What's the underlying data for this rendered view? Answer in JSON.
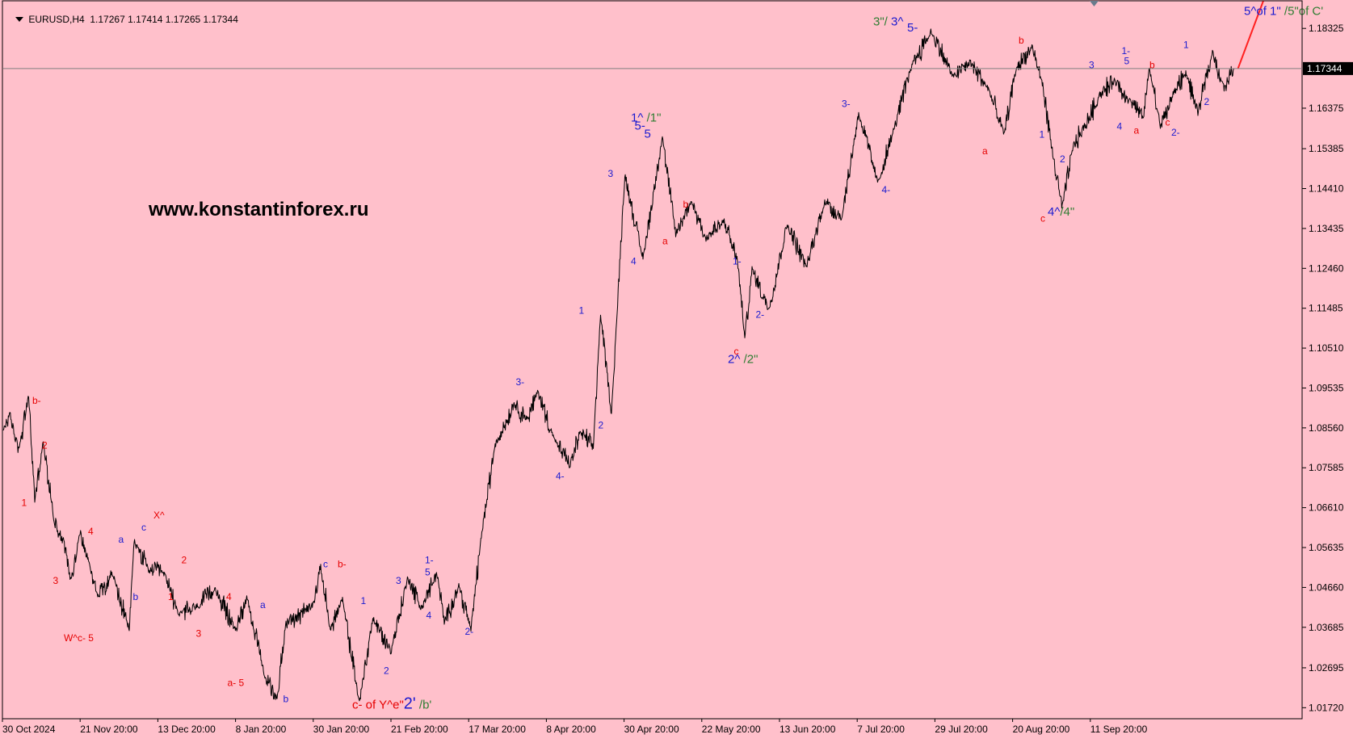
{
  "header": {
    "symbol": "EURUSD,H4",
    "ohlc": "1.17267 1.17414 1.17265 1.17344"
  },
  "watermark": "www.konstantinforex.ru",
  "colors": {
    "background": "#ffc0cb",
    "price_line": "#000000",
    "red_labels": "#e60000",
    "blue_labels": "#1a1ad0",
    "green_labels": "#2e7d32",
    "projection": "#ff2020",
    "current_price_box": "#000000"
  },
  "chart_data": {
    "type": "line",
    "title": "EURUSD,H4",
    "grid": false,
    "current_price": 1.17344,
    "current_price_label": "1.17344",
    "y_tick_labels": [
      "1.18325",
      "1.17344",
      "1.16375",
      "1.15385",
      "1.14410",
      "1.13435",
      "1.12460",
      "1.11485",
      "1.10510",
      "1.09535",
      "1.08560",
      "1.07585",
      "1.06610",
      "1.05635",
      "1.04660",
      "1.03685",
      "1.02695",
      "1.01720"
    ],
    "y_ticks": [
      1.18325,
      1.16375,
      1.15385,
      1.1441,
      1.13435,
      1.1246,
      1.11485,
      1.1051,
      1.09535,
      1.0856,
      1.07585,
      1.0661,
      1.05635,
      1.0466,
      1.03685,
      1.02695,
      1.0172
    ],
    "ylim": [
      1.0145,
      1.19
    ],
    "x_tick_labels": [
      "30 Oct 2024",
      "21 Nov 20:00",
      "13 Dec 20:00",
      "8 Jan 20:00",
      "30 Jan 20:00",
      "21 Feb 20:00",
      "17 Mar 20:00",
      "8 Apr 20:00",
      "30 Apr 20:00",
      "22 May 20:00",
      "13 Jun 20:00",
      "7 Jul 20:00",
      "29 Jul 20:00",
      "20 Aug 20:00",
      "11 Sep 20:00"
    ],
    "key_points": [
      {
        "t": 0.0,
        "y": 1.085
      },
      {
        "t": 0.5,
        "y": 1.089
      },
      {
        "t": 1.3,
        "y": 1.08
      },
      {
        "t": 2.1,
        "y": 1.0935
      },
      {
        "t": 2.6,
        "y": 1.068
      },
      {
        "t": 3.3,
        "y": 1.082
      },
      {
        "t": 4.2,
        "y": 1.063
      },
      {
        "t": 5.0,
        "y": 1.058
      },
      {
        "t": 5.6,
        "y": 1.048
      },
      {
        "t": 6.3,
        "y": 1.06
      },
      {
        "t": 7.0,
        "y": 1.0535
      },
      {
        "t": 7.8,
        "y": 1.045
      },
      {
        "t": 9.0,
        "y": 1.05
      },
      {
        "t": 10.4,
        "y": 1.036
      },
      {
        "t": 10.8,
        "y": 1.058
      },
      {
        "t": 12.0,
        "y": 1.051
      },
      {
        "t": 13.3,
        "y": 1.05
      },
      {
        "t": 14.5,
        "y": 1.04
      },
      {
        "t": 16.0,
        "y": 1.042
      },
      {
        "t": 17.5,
        "y": 1.046
      },
      {
        "t": 19.2,
        "y": 1.036
      },
      {
        "t": 20.1,
        "y": 1.0445
      },
      {
        "t": 21.6,
        "y": 1.0245
      },
      {
        "t": 22.6,
        "y": 1.0195
      },
      {
        "t": 23.3,
        "y": 1.0375
      },
      {
        "t": 25.6,
        "y": 1.0425
      },
      {
        "t": 26.2,
        "y": 1.0515
      },
      {
        "t": 27.0,
        "y": 1.0365
      },
      {
        "t": 28.0,
        "y": 1.0435
      },
      {
        "t": 29.4,
        "y": 1.0185
      },
      {
        "t": 30.5,
        "y": 1.039
      },
      {
        "t": 32.0,
        "y": 1.031
      },
      {
        "t": 33.4,
        "y": 1.049
      },
      {
        "t": 34.5,
        "y": 1.0415
      },
      {
        "t": 35.8,
        "y": 1.05
      },
      {
        "t": 36.4,
        "y": 1.038
      },
      {
        "t": 37.6,
        "y": 1.047
      },
      {
        "t": 38.6,
        "y": 1.0365
      },
      {
        "t": 39.5,
        "y": 1.06
      },
      {
        "t": 40.6,
        "y": 1.0815
      },
      {
        "t": 42.2,
        "y": 1.0915
      },
      {
        "t": 43.3,
        "y": 1.0875
      },
      {
        "t": 44.1,
        "y": 1.0945
      },
      {
        "t": 45.6,
        "y": 1.082
      },
      {
        "t": 46.8,
        "y": 1.0765
      },
      {
        "t": 47.6,
        "y": 1.0845
      },
      {
        "t": 48.7,
        "y": 1.081
      },
      {
        "t": 49.3,
        "y": 1.1135
      },
      {
        "t": 50.2,
        "y": 1.089
      },
      {
        "t": 51.3,
        "y": 1.1475
      },
      {
        "t": 52.8,
        "y": 1.127
      },
      {
        "t": 54.4,
        "y": 1.1565
      },
      {
        "t": 55.5,
        "y": 1.133
      },
      {
        "t": 56.8,
        "y": 1.141
      },
      {
        "t": 58.0,
        "y": 1.132
      },
      {
        "t": 59.5,
        "y": 1.136
      },
      {
        "t": 60.6,
        "y": 1.1265
      },
      {
        "t": 61.2,
        "y": 1.1075
      },
      {
        "t": 61.8,
        "y": 1.1245
      },
      {
        "t": 63.2,
        "y": 1.1145
      },
      {
        "t": 64.7,
        "y": 1.1355
      },
      {
        "t": 66.3,
        "y": 1.125
      },
      {
        "t": 67.8,
        "y": 1.141
      },
      {
        "t": 69.2,
        "y": 1.137
      },
      {
        "t": 70.6,
        "y": 1.1625
      },
      {
        "t": 72.2,
        "y": 1.1455
      },
      {
        "t": 73.5,
        "y": 1.1585
      },
      {
        "t": 75.0,
        "y": 1.1745
      },
      {
        "t": 76.6,
        "y": 1.1825
      },
      {
        "t": 78.4,
        "y": 1.1715
      },
      {
        "t": 79.8,
        "y": 1.175
      },
      {
        "t": 81.3,
        "y": 1.1685
      },
      {
        "t": 82.6,
        "y": 1.1575
      },
      {
        "t": 83.6,
        "y": 1.1735
      },
      {
        "t": 84.9,
        "y": 1.1785
      },
      {
        "t": 85.8,
        "y": 1.1695
      },
      {
        "t": 86.5,
        "y": 1.1545
      },
      {
        "t": 87.4,
        "y": 1.1395
      },
      {
        "t": 88.3,
        "y": 1.1545
      },
      {
        "t": 89.2,
        "y": 1.159
      },
      {
        "t": 90.5,
        "y": 1.167
      },
      {
        "t": 91.7,
        "y": 1.1705
      },
      {
        "t": 93.0,
        "y": 1.1655
      },
      {
        "t": 94.1,
        "y": 1.1615
      },
      {
        "t": 94.6,
        "y": 1.1735
      },
      {
        "t": 95.5,
        "y": 1.1595
      },
      {
        "t": 96.8,
        "y": 1.1685
      },
      {
        "t": 97.6,
        "y": 1.1725
      },
      {
        "t": 98.6,
        "y": 1.1625
      },
      {
        "t": 99.8,
        "y": 1.1775
      },
      {
        "t": 100.8,
        "y": 1.1685
      },
      {
        "t": 101.6,
        "y": 1.1734
      }
    ],
    "projection": [
      {
        "t": 101.9,
        "y": 1.1734
      },
      {
        "t": 104.0,
        "y": 1.19
      }
    ],
    "annotations": [
      {
        "text": "b-",
        "t": 2.4,
        "y": 1.0915,
        "color": "red"
      },
      {
        "text": "2",
        "t": 3.2,
        "y": 1.0805,
        "color": "red"
      },
      {
        "text": "1",
        "t": 1.5,
        "y": 1.0665,
        "color": "red"
      },
      {
        "text": "4",
        "t": 7.0,
        "y": 1.0595,
        "color": "red"
      },
      {
        "text": "3",
        "t": 4.1,
        "y": 1.0475,
        "color": "red"
      },
      {
        "text": "W^c- 5",
        "t": 5.0,
        "y": 1.0335,
        "color": "red"
      },
      {
        "text": "a",
        "t": 9.5,
        "y": 1.0575,
        "color": "blue"
      },
      {
        "text": "c",
        "t": 11.4,
        "y": 1.0605,
        "color": "blue"
      },
      {
        "text": "X^",
        "t": 12.4,
        "y": 1.0635,
        "color": "red"
      },
      {
        "text": "b",
        "t": 10.7,
        "y": 1.0435,
        "color": "blue"
      },
      {
        "text": "2",
        "t": 14.7,
        "y": 1.0525,
        "color": "red"
      },
      {
        "text": "1",
        "t": 13.6,
        "y": 1.0435,
        "color": "red"
      },
      {
        "text": "4",
        "t": 18.4,
        "y": 1.0435,
        "color": "red"
      },
      {
        "text": "3",
        "t": 15.9,
        "y": 1.0345,
        "color": "red"
      },
      {
        "text": "a",
        "t": 21.2,
        "y": 1.0415,
        "color": "blue"
      },
      {
        "text": "a- 5",
        "t": 18.5,
        "y": 1.0225,
        "color": "red"
      },
      {
        "text": "b",
        "t": 23.1,
        "y": 1.0185,
        "color": "blue"
      },
      {
        "text": "c",
        "t": 26.4,
        "y": 1.0515,
        "color": "blue"
      },
      {
        "text": "b-",
        "t": 27.6,
        "y": 1.0515,
        "color": "red"
      },
      {
        "text": "1",
        "t": 29.5,
        "y": 1.0425,
        "color": "blue"
      },
      {
        "text": "3",
        "t": 32.4,
        "y": 1.0475,
        "color": "blue"
      },
      {
        "text": "2",
        "t": 31.4,
        "y": 1.0255,
        "color": "blue"
      },
      {
        "text": "1-",
        "t": 34.8,
        "y": 1.0525,
        "color": "blue"
      },
      {
        "text": "5",
        "t": 34.8,
        "y": 1.0495,
        "color": "blue"
      },
      {
        "text": "4",
        "t": 34.9,
        "y": 1.039,
        "color": "blue"
      },
      {
        "text": "2-",
        "t": 38.1,
        "y": 1.035,
        "color": "blue"
      },
      {
        "text": "3-",
        "t": 42.3,
        "y": 1.096,
        "color": "blue"
      },
      {
        "text": "4-",
        "t": 45.6,
        "y": 1.073,
        "color": "blue"
      },
      {
        "text": "1",
        "t": 47.5,
        "y": 1.1135,
        "color": "blue"
      },
      {
        "text": "2",
        "t": 49.1,
        "y": 1.0855,
        "color": "blue"
      },
      {
        "text": "3",
        "t": 49.9,
        "y": 1.147,
        "color": "blue"
      },
      {
        "text": "4",
        "t": 51.8,
        "y": 1.1255,
        "color": "blue"
      },
      {
        "text": "a",
        "t": 54.4,
        "y": 1.1305,
        "color": "red"
      },
      {
        "text": "b",
        "t": 56.1,
        "y": 1.1395,
        "color": "red"
      },
      {
        "text": "1-",
        "t": 60.2,
        "y": 1.1255,
        "color": "blue"
      },
      {
        "text": "2-",
        "t": 62.1,
        "y": 1.1125,
        "color": "blue"
      },
      {
        "text": "c",
        "t": 60.3,
        "y": 1.1035,
        "color": "red"
      },
      {
        "text": "3-",
        "t": 69.2,
        "y": 1.164,
        "color": "blue"
      },
      {
        "text": "4-",
        "t": 72.5,
        "y": 1.143,
        "color": "blue"
      },
      {
        "text": "a",
        "t": 80.8,
        "y": 1.1525,
        "color": "red"
      },
      {
        "text": "b",
        "t": 83.8,
        "y": 1.1795,
        "color": "red"
      },
      {
        "text": "1",
        "t": 85.5,
        "y": 1.1565,
        "color": "blue"
      },
      {
        "text": "2",
        "t": 87.2,
        "y": 1.1505,
        "color": "blue"
      },
      {
        "text": "c",
        "t": 85.6,
        "y": 1.136,
        "color": "red"
      },
      {
        "text": "3",
        "t": 89.6,
        "y": 1.1735,
        "color": "blue"
      },
      {
        "text": "1-",
        "t": 92.3,
        "y": 1.177,
        "color": "blue"
      },
      {
        "text": "5",
        "t": 92.5,
        "y": 1.1745,
        "color": "blue"
      },
      {
        "text": "4",
        "t": 91.9,
        "y": 1.1585,
        "color": "blue"
      },
      {
        "text": "b",
        "t": 94.6,
        "y": 1.1735,
        "color": "red"
      },
      {
        "text": "a",
        "t": 93.3,
        "y": 1.1575,
        "color": "red"
      },
      {
        "text": "c",
        "t": 95.9,
        "y": 1.1595,
        "color": "red"
      },
      {
        "text": "2-",
        "t": 96.4,
        "y": 1.157,
        "color": "blue"
      },
      {
        "text": "1",
        "t": 97.4,
        "y": 1.1785,
        "color": "blue"
      },
      {
        "text": "2",
        "t": 99.1,
        "y": 1.1645,
        "color": "blue"
      }
    ],
    "wave_labels": [
      {
        "t": 51.8,
        "y": 1.1605,
        "parts": [
          {
            "text": "1^ ",
            "color": "blue"
          },
          {
            "text": "/1\"",
            "color": "green"
          }
        ]
      },
      {
        "t": 52.1,
        "y": 1.1585,
        "parts": [
          {
            "text": "5-",
            "color": "blue"
          }
        ]
      },
      {
        "t": 52.9,
        "y": 1.1565,
        "parts": [
          {
            "text": "5",
            "color": "blue"
          }
        ]
      },
      {
        "t": 59.8,
        "y": 1.1015,
        "parts": [
          {
            "text": "2^ ",
            "color": "blue"
          },
          {
            "text": "/2\"",
            "color": "green"
          }
        ]
      },
      {
        "t": 71.8,
        "y": 1.184,
        "parts": [
          {
            "text": "3\"/ ",
            "color": "green"
          },
          {
            "text": "3^",
            "color": "blue"
          }
        ]
      },
      {
        "t": 74.6,
        "y": 1.1825,
        "parts": [
          {
            "text": "5-",
            "color": "blue"
          }
        ]
      },
      {
        "t": 86.2,
        "y": 1.1375,
        "parts": [
          {
            "text": "4^",
            "color": "blue"
          },
          {
            "text": "/4\"",
            "color": "green"
          }
        ]
      },
      {
        "t": 28.8,
        "y": 1.017,
        "parts": [
          {
            "text": "c- of Y^",
            "color": "red"
          },
          {
            "text": "e\"",
            "color": "red"
          },
          {
            "text": "2'",
            "color": "blue"
          },
          {
            "text": " /b'",
            "color": "green"
          }
        ]
      },
      {
        "t": 102.4,
        "y": 1.1865,
        "parts": [
          {
            "text": "5^of 1\"",
            "color": "blue"
          },
          {
            "text": " /5\"of C'",
            "color": "green"
          }
        ]
      }
    ]
  }
}
